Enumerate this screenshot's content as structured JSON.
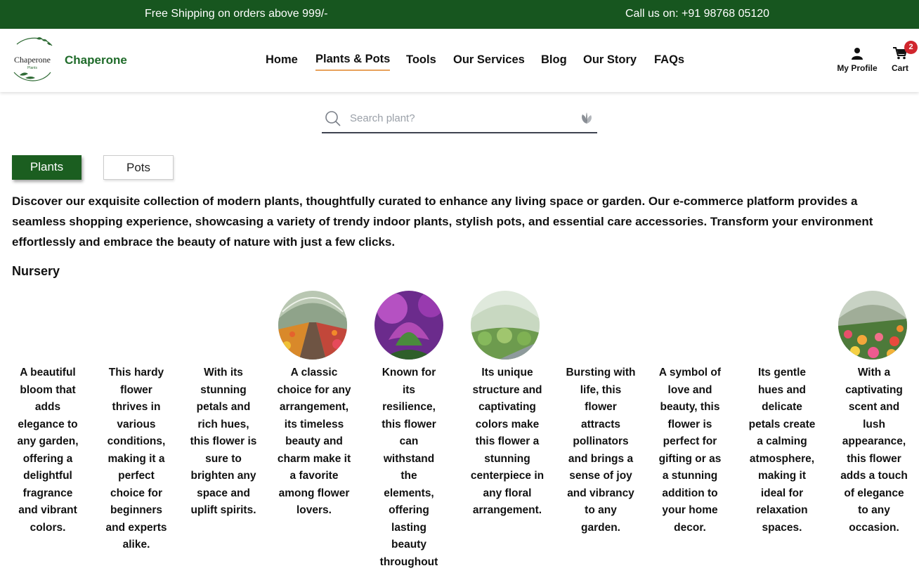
{
  "topbar": {
    "promo": "Free Shipping on orders above 999/-",
    "phone": "Call us on: +91 98768 05120"
  },
  "header": {
    "logo_text": "Chaperone",
    "logo_subtext": "Plants",
    "brand": "Chaperone",
    "nav": [
      "Home",
      "Plants & Pots",
      "Tools",
      "Our Services",
      "Blog",
      "Our Story",
      "FAQs"
    ],
    "active_nav": "Plants & Pots",
    "profile_label": "My Profile",
    "cart_label": "Cart",
    "cart_count": "2"
  },
  "search": {
    "placeholder": "Search plant?"
  },
  "tabs": {
    "plants": "Plants",
    "pots": "Pots",
    "selected": "Plants"
  },
  "intro": "Discover our exquisite collection of modern plants, thoughtfully curated to enhance any living space or garden. Our e-commerce platform provides a seamless shopping experience, showcasing a variety of trendy indoor plants, stylish pots, and essential care accessories. Transform your environment effortlessly and embrace the beauty of nature with just a few clicks.",
  "section_title": "Nursery",
  "products": [
    {
      "description": "A beautiful bloom that adds elegance to any garden, offering a delightful fragrance and vibrant colors."
    },
    {
      "description": "This hardy flower thrives in various conditions, making it a perfect choice for beginners and experts alike."
    },
    {
      "description": "With its stunning petals and rich hues, this flower is sure to brighten any space and uplift spirits."
    },
    {
      "description": "A classic choice for any arrangement, its timeless beauty and charm make it a favorite among flower lovers."
    },
    {
      "description": "Known for its resilience, this flower can withstand the elements, offering lasting beauty throughout"
    },
    {
      "description": "Its unique structure and captivating colors make this flower a stunning centerpiece in any floral arrangement."
    },
    {
      "description": "Bursting with life, this flower attracts pollinators and brings a sense of joy and vibrancy to any garden."
    },
    {
      "description": "A symbol of love and beauty, this flower is perfect for gifting or as a stunning addition to your home decor."
    },
    {
      "description": "Its gentle hues and delicate petals create a calming atmosphere, making it ideal for relaxation spaces."
    },
    {
      "description": "With a captivating scent and lush appearance, this flower adds a touch of elegance to any occasion."
    }
  ],
  "colors": {
    "brand_green": "#17561f",
    "active_underline": "#e8a25c",
    "cart_badge": "#d0262d"
  }
}
